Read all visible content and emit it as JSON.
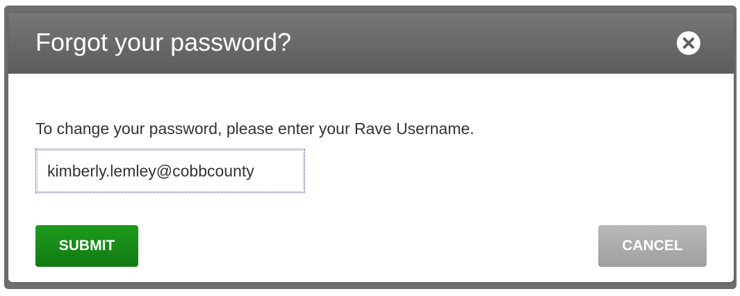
{
  "dialog": {
    "title": "Forgot your password?",
    "close_icon": "close-icon",
    "instructions": "To change your password, please enter your Rave Username.",
    "username_value": "kimberly.lemley@cobbcounty",
    "submit_label": "SUBMIT",
    "cancel_label": "CANCEL"
  },
  "colors": {
    "header": "#666666",
    "submit": "#188d18",
    "cancel": "#aaaaaa"
  }
}
